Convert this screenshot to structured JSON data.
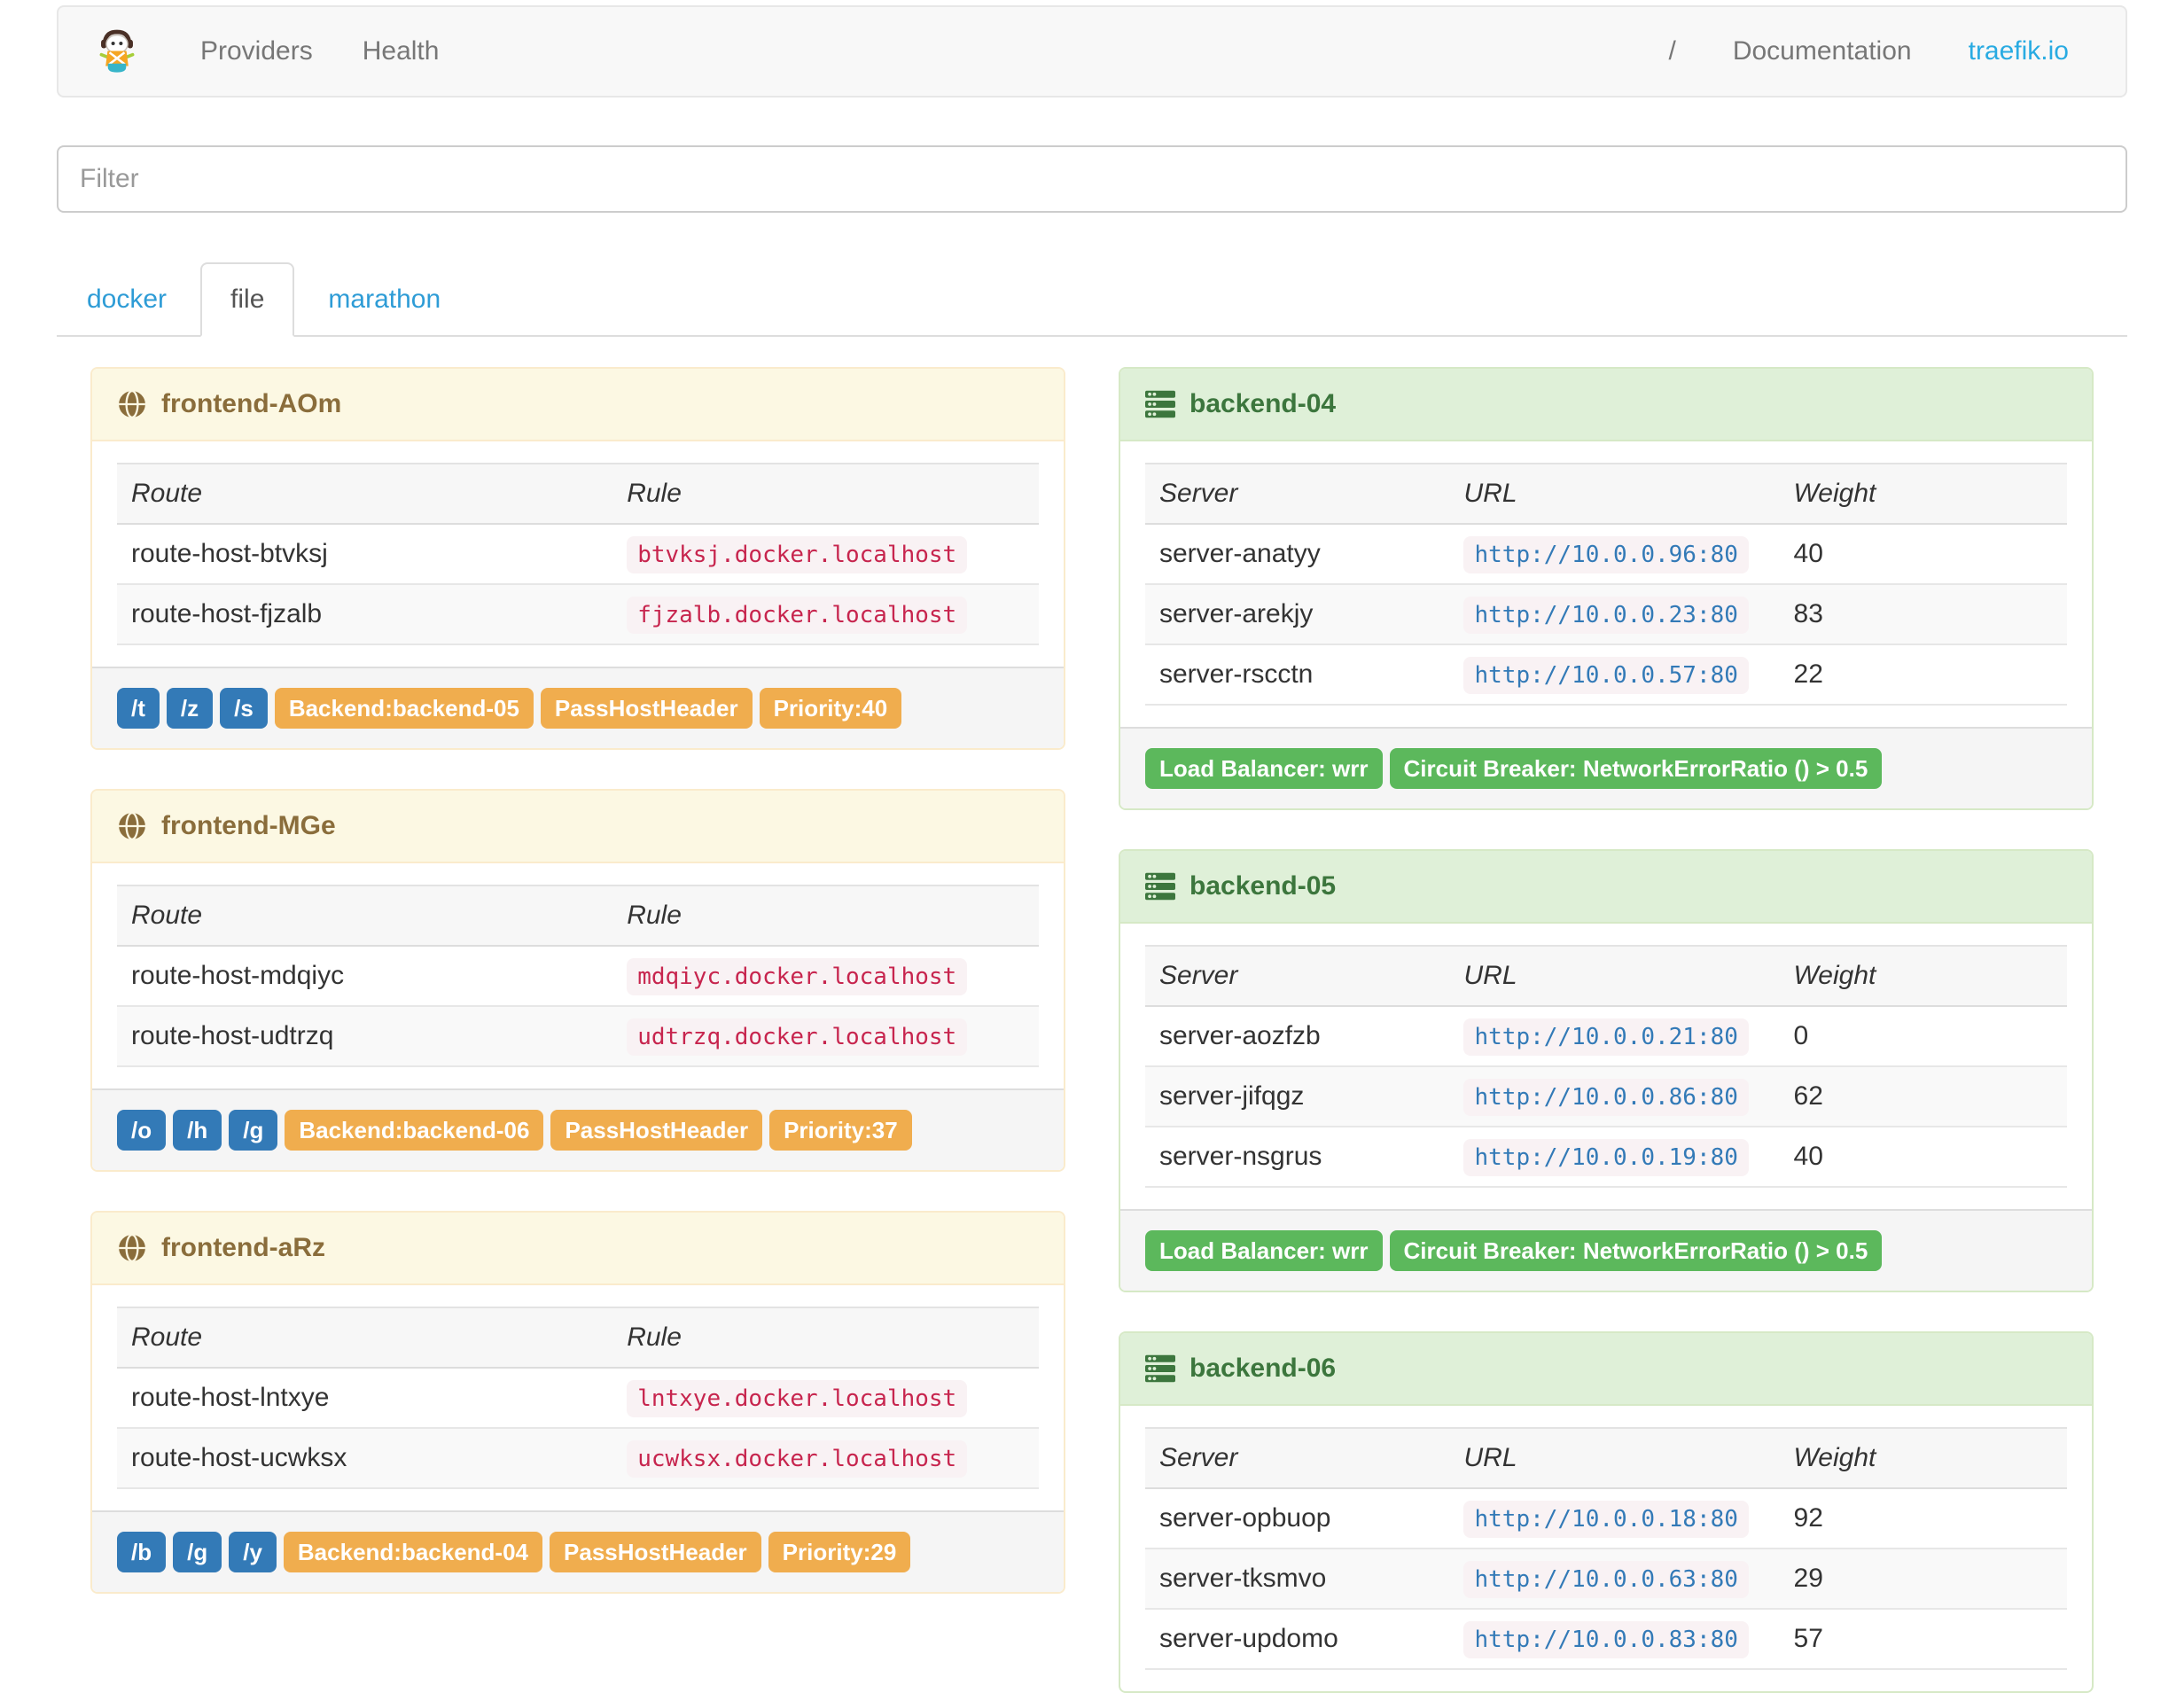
{
  "navbar": {
    "brand_icon": "traefik-logo",
    "links": [
      {
        "label": "Providers"
      },
      {
        "label": "Health"
      }
    ],
    "right_links": [
      {
        "label": "/"
      },
      {
        "label": "Documentation"
      },
      {
        "label": "traefik.io",
        "accent": true
      }
    ]
  },
  "filter": {
    "placeholder": "Filter"
  },
  "tabs": [
    {
      "label": "docker",
      "active": false
    },
    {
      "label": "file",
      "active": true
    },
    {
      "label": "marathon",
      "active": false
    }
  ],
  "table_headers": {
    "frontend": [
      "Route",
      "Rule"
    ],
    "backend": [
      "Server",
      "URL",
      "Weight"
    ]
  },
  "frontends": [
    {
      "title": "frontend-AOm",
      "rows": [
        {
          "route": "route-host-btvksj",
          "rule": "btvksj.docker.localhost"
        },
        {
          "route": "route-host-fjzalb",
          "rule": "fjzalb.docker.localhost"
        }
      ],
      "path_tags": [
        "/t",
        "/z",
        "/s"
      ],
      "tags": [
        "Backend:backend-05",
        "PassHostHeader",
        "Priority:40"
      ]
    },
    {
      "title": "frontend-MGe",
      "rows": [
        {
          "route": "route-host-mdqiyc",
          "rule": "mdqiyc.docker.localhost"
        },
        {
          "route": "route-host-udtrzq",
          "rule": "udtrzq.docker.localhost"
        }
      ],
      "path_tags": [
        "/o",
        "/h",
        "/g"
      ],
      "tags": [
        "Backend:backend-06",
        "PassHostHeader",
        "Priority:37"
      ]
    },
    {
      "title": "frontend-aRz",
      "rows": [
        {
          "route": "route-host-lntxye",
          "rule": "lntxye.docker.localhost"
        },
        {
          "route": "route-host-ucwksx",
          "rule": "ucwksx.docker.localhost"
        }
      ],
      "path_tags": [
        "/b",
        "/g",
        "/y"
      ],
      "tags": [
        "Backend:backend-04",
        "PassHostHeader",
        "Priority:29"
      ]
    }
  ],
  "backends": [
    {
      "title": "backend-04",
      "servers": [
        {
          "name": "server-anatyy",
          "url": "http://10.0.0.96:80",
          "weight": "40"
        },
        {
          "name": "server-arekjy",
          "url": "http://10.0.0.23:80",
          "weight": "83"
        },
        {
          "name": "server-rscctn",
          "url": "http://10.0.0.57:80",
          "weight": "22"
        }
      ],
      "tags": [
        "Load Balancer: wrr",
        "Circuit Breaker: NetworkErrorRatio () > 0.5"
      ]
    },
    {
      "title": "backend-05",
      "servers": [
        {
          "name": "server-aozfzb",
          "url": "http://10.0.0.21:80",
          "weight": "0"
        },
        {
          "name": "server-jifqgz",
          "url": "http://10.0.0.86:80",
          "weight": "62"
        },
        {
          "name": "server-nsgrus",
          "url": "http://10.0.0.19:80",
          "weight": "40"
        }
      ],
      "tags": [
        "Load Balancer: wrr",
        "Circuit Breaker: NetworkErrorRatio () > 0.5"
      ]
    },
    {
      "title": "backend-06",
      "servers": [
        {
          "name": "server-opbuop",
          "url": "http://10.0.0.18:80",
          "weight": "92"
        },
        {
          "name": "server-tksmvo",
          "url": "http://10.0.0.63:80",
          "weight": "29"
        },
        {
          "name": "server-updomo",
          "url": "http://10.0.0.83:80",
          "weight": "57"
        }
      ],
      "tags": []
    }
  ],
  "colors": {
    "tab_link": "#2e9cd6",
    "brand_link": "#29abe2",
    "frontend_heading_bg": "#fcf8e3",
    "frontend_heading_text": "#8a6d3b",
    "backend_heading_bg": "#dff0d8",
    "backend_heading_text": "#3c763d",
    "label_blue": "#337ab7",
    "label_orange": "#f0ad4e",
    "label_green": "#5cb85c",
    "code_bg": "#f9f2f4",
    "rule_text": "#c7254e",
    "url_text": "#337ab7"
  }
}
